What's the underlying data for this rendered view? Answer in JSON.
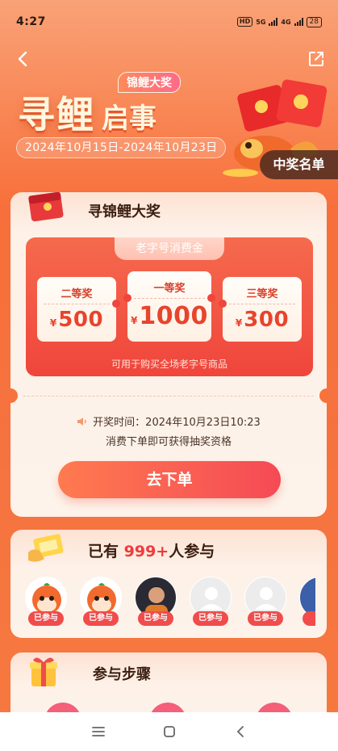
{
  "status_bar": {
    "time": "4:27",
    "hd": "HD",
    "net1": "5G",
    "net2": "4G",
    "battery": "28"
  },
  "hero": {
    "tag": "锦鲤大奖",
    "title_main": "寻鲤",
    "title_sub": "启事",
    "date_range": "2024年10月15日-2024年10月23日",
    "winners_label": "中奖名单"
  },
  "prize_section": {
    "title": "寻锦鲤大奖",
    "box_header": "老字号消费金",
    "tickets": [
      {
        "rank": "二等奖",
        "currency": "¥",
        "amount": "500"
      },
      {
        "rank": "一等奖",
        "currency": "¥",
        "amount": "1000"
      },
      {
        "rank": "三等奖",
        "currency": "¥",
        "amount": "300"
      }
    ],
    "note": "可用于购买全场老字号商品",
    "draw_time": "开奖时间：2024年10月23日10:23",
    "draw_note": "消费下单即可获得抽奖资格",
    "order_button": "去下单"
  },
  "participants": {
    "title_prefix": "已有",
    "count": "999+",
    "title_suffix": "人参与",
    "badge": "已参与",
    "avatars": [
      "mascot",
      "mascot",
      "photo",
      "default",
      "default",
      "partial"
    ]
  },
  "steps": {
    "title": "参与步骤"
  },
  "colors": {
    "accent": "#f04c4c",
    "brand_orange": "#f7733d",
    "text_dark": "#3a1e10"
  }
}
